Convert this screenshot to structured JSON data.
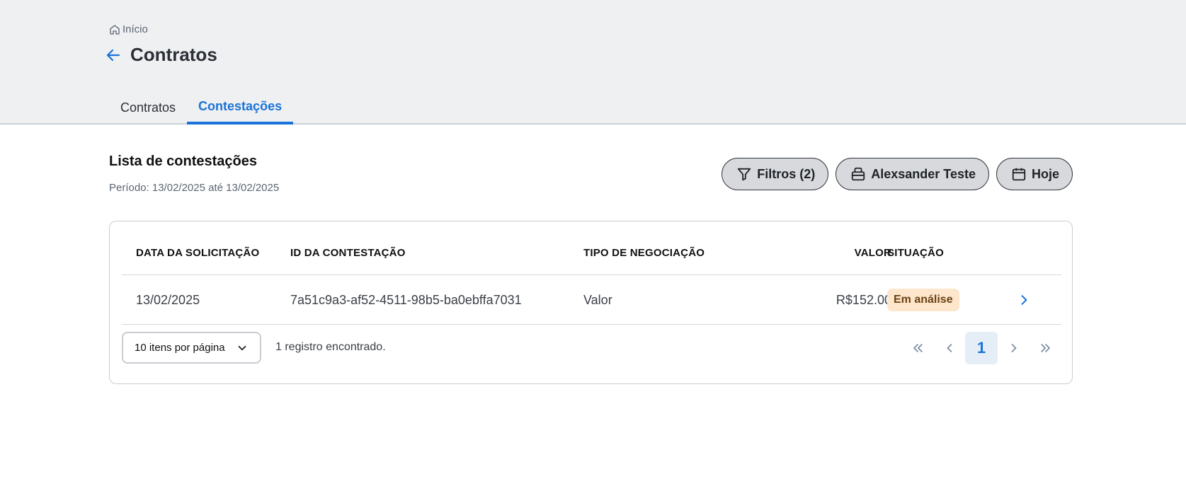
{
  "breadcrumb": {
    "label": "Início",
    "icon": "home-icon"
  },
  "header": {
    "title": "Contratos"
  },
  "tabs": [
    {
      "label": "Contratos",
      "active": false
    },
    {
      "label": "Contestações",
      "active": true
    }
  ],
  "section": {
    "title": "Lista de contestações",
    "period": "Período: 13/02/2025 até 13/02/2025"
  },
  "actions": {
    "filters_label": "Filtros (2)",
    "account_label": "Alexsander Teste",
    "date_label": "Hoje"
  },
  "table": {
    "columns": [
      "DATA DA SOLICITAÇÃO",
      "ID DA CONTESTAÇÃO",
      "TIPO DE NEGOCIAÇÃO",
      "VALOR",
      "SITUAÇÃO"
    ],
    "rows": [
      {
        "date": "13/02/2025",
        "id": "7a51c9a3-af52-4511-98b5-ba0ebffa7031",
        "type": "Valor",
        "value": "R$152.00",
        "status": "Em análise"
      }
    ]
  },
  "pagination": {
    "page_size_label": "10 itens por página",
    "records_text": "1 registro encontrado.",
    "current_page": "1"
  },
  "colors": {
    "accent": "#1a73d8",
    "header_bg": "#eff0f2",
    "status_badge_bg": "#fde6cc",
    "status_badge_text": "#6b4212"
  }
}
